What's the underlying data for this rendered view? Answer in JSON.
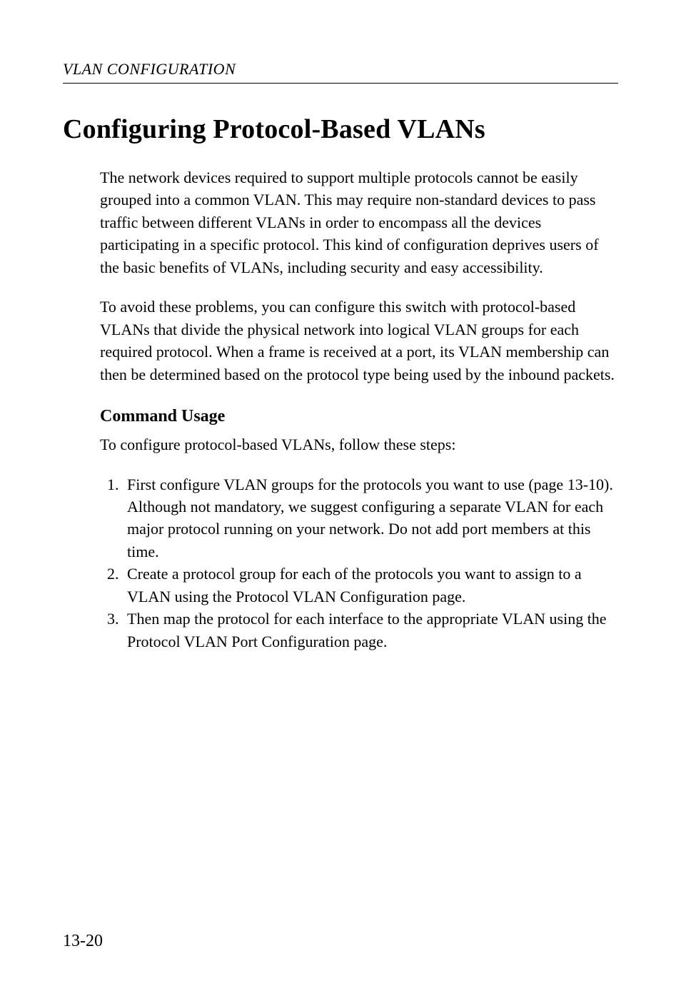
{
  "running_head": "VLAN CONFIGURATION",
  "title": "Configuring Protocol-Based VLANs",
  "para1": "The network devices required to support multiple protocols cannot be easily grouped into a common VLAN. This may require non-standard devices to pass traffic between different VLANs in order to encompass all the devices participating in a specific protocol. This kind of configuration deprives users of the basic benefits of VLANs, including security and easy accessibility.",
  "para2": "To avoid these problems, you can configure this switch with protocol-based VLANs that divide the physical network into logical VLAN groups for each required protocol. When a frame is received at a port, its VLAN membership can then be determined based on the protocol type being used by the inbound packets.",
  "subhead": "Command Usage",
  "para3": "To configure protocol-based VLANs, follow these steps:",
  "steps": [
    "First configure VLAN groups for the protocols you want to use (page 13-10). Although not mandatory, we suggest configuring a separate VLAN for each major protocol running on your network. Do not add port members at this time.",
    "Create a protocol group for each of the protocols you want to assign to a VLAN using the Protocol VLAN Configuration page.",
    "Then map the protocol for each interface to the appropriate VLAN using the Protocol VLAN Port Configuration page."
  ],
  "page_number": "13-20"
}
